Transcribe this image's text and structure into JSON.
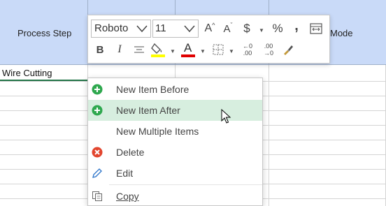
{
  "sheet": {
    "headers": {
      "col_a": "Process Step",
      "col_mode": "Mode"
    },
    "cells": {
      "a2": "Wire Cutting"
    }
  },
  "toolbar": {
    "font_name": "Roboto",
    "font_size": "11",
    "increase_font_icon": "A",
    "decrease_font_icon": "A",
    "currency_icon": "$",
    "percent_icon": "%",
    "comma_icon": ",",
    "bold_icon": "B",
    "italic_icon": "I",
    "font_color_icon": "A",
    "inc_decimal_top": "←0",
    "inc_decimal_bottom": ".00",
    "dec_decimal_top": ".00",
    "dec_decimal_bottom": "→0",
    "fill_color": "#ffff00",
    "font_color": "#e00000"
  },
  "context_menu": {
    "items": [
      {
        "label": "New Item Before",
        "icon": "plus-circle-green"
      },
      {
        "label": "New Item After",
        "icon": "plus-circle-green"
      },
      {
        "label": "New Multiple Items",
        "icon": ""
      },
      {
        "label": "Delete",
        "icon": "x-circle-red"
      },
      {
        "label": "Edit",
        "icon": "pencil-blue"
      },
      {
        "label": "Copy",
        "icon": "copy-icon"
      }
    ],
    "hovered_index": 1
  },
  "colors": {
    "header_bg": "#c9daf8",
    "hover_bg": "#d7eedf",
    "green": "#2ea84e",
    "red": "#e2452e"
  }
}
